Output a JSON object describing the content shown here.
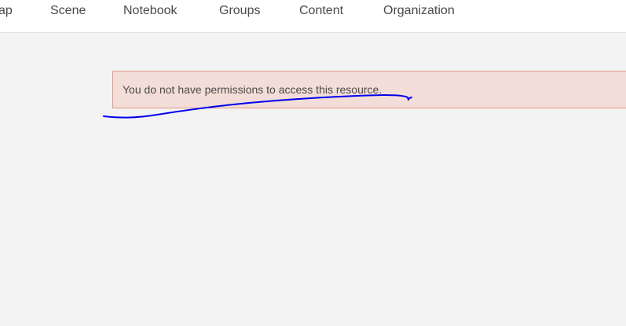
{
  "nav": {
    "items": [
      {
        "label": "ap"
      },
      {
        "label": "Scene"
      },
      {
        "label": "Notebook"
      },
      {
        "label": "Groups"
      },
      {
        "label": "Content"
      },
      {
        "label": "Organization"
      }
    ]
  },
  "alert": {
    "message": "You do not have permissions to access this resource."
  },
  "colors": {
    "alert_background": "#f3ddd8",
    "alert_border": "#de9a8c",
    "annotation_stroke": "#0000ee"
  }
}
